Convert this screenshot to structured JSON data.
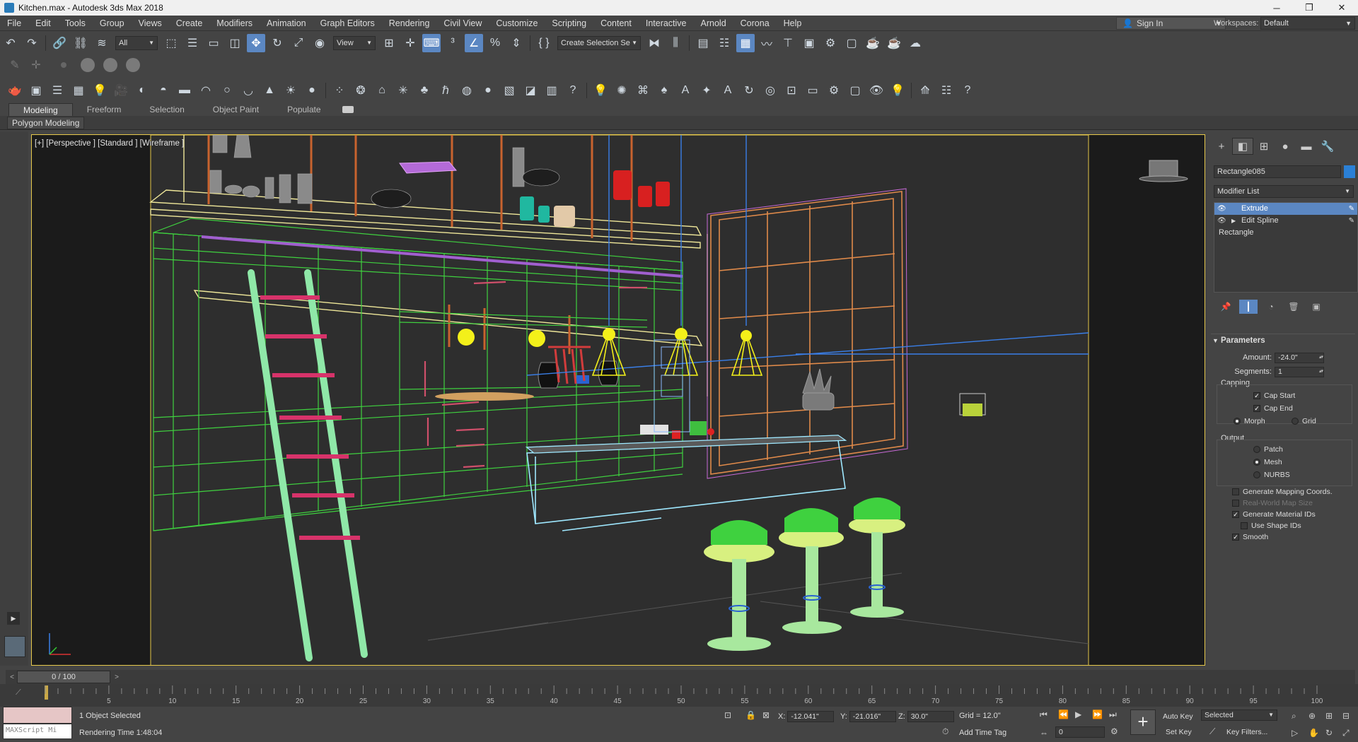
{
  "window": {
    "title": "Kitchen.max - Autodesk 3ds Max 2018",
    "minimize": "─",
    "restore": "❐",
    "close": "✕"
  },
  "menu": {
    "items": [
      "File",
      "Edit",
      "Tools",
      "Group",
      "Views",
      "Create",
      "Modifiers",
      "Animation",
      "Graph Editors",
      "Rendering",
      "Civil View",
      "Customize",
      "Scripting",
      "Content",
      "Interactive",
      "Arnold",
      "Corona",
      "Help"
    ],
    "sign_in": "Sign In",
    "workspaces_label": "Workspaces:",
    "workspace_value": "Default"
  },
  "toolbar": {
    "selection_filter": "All",
    "reference_coord": "View",
    "selection_set": "Create Selection Se"
  },
  "ribbon": {
    "tabs": [
      "Modeling",
      "Freeform",
      "Selection",
      "Object Paint",
      "Populate"
    ],
    "active_tab": "Modeling",
    "sub_panel": "Polygon Modeling"
  },
  "viewport": {
    "label": "[+] [Perspective ] [Standard ] [Wireframe ]",
    "colors": {
      "background": "#2a2a2a",
      "border": "#e6c84b",
      "cabinet": "#3fd13f",
      "ladder": "#8fe8a8",
      "ladder_rungs": "#d7336a",
      "window_frame": "#e08a4a",
      "shelf": "#f0e89a",
      "lamps": "#f3f01a",
      "island": "#9fe8ff",
      "stools": "#a8e89e",
      "light_lines": "#3a7fe8"
    }
  },
  "command_panel": {
    "tab_icons": [
      "create-icon",
      "modify-icon",
      "hierarchy-icon",
      "motion-icon",
      "display-icon",
      "utilities-icon"
    ],
    "object_name": "Rectangle085",
    "object_color": "#2b80d6",
    "modifier_list_label": "Modifier List",
    "stack": [
      {
        "name": "Extrude",
        "selected": true
      },
      {
        "name": "Edit Spline",
        "selected": false
      },
      {
        "name": "Rectangle",
        "selected": false
      }
    ],
    "parameters": {
      "title": "Parameters",
      "amount_label": "Amount:",
      "amount_value": "-24.0\"",
      "segments_label": "Segments:",
      "segments_value": "1",
      "capping_title": "Capping",
      "cap_start": "Cap Start",
      "cap_end": "Cap End",
      "morph": "Morph",
      "grid": "Grid",
      "output_title": "Output",
      "patch": "Patch",
      "mesh": "Mesh",
      "nurbs": "NURBS",
      "gen_mapping": "Generate Mapping Coords.",
      "real_world": "Real-World Map Size",
      "gen_material": "Generate Material IDs",
      "use_shape": "Use Shape IDs",
      "smooth": "Smooth"
    }
  },
  "timeline": {
    "frame_readout": "0 / 100",
    "ticks": [
      "5",
      "10",
      "15",
      "20",
      "25",
      "30",
      "35",
      "40",
      "45",
      "50",
      "55",
      "60",
      "65",
      "70",
      "75",
      "80",
      "85",
      "90",
      "95",
      "100"
    ]
  },
  "status": {
    "maxscript_placeholder": "MAXScript Mi",
    "selection_count": "1 Object Selected",
    "render_time": "Rendering Time  1:48:04",
    "x_label": "X:",
    "x_value": "-12.041\"",
    "y_label": "Y:",
    "y_value": "-21.016\"",
    "z_label": "Z:",
    "z_value": "30.0\"",
    "grid": "Grid = 12.0\"",
    "add_time_tag": "Add Time Tag",
    "auto_key": "Auto Key",
    "set_key": "Set Key",
    "selected": "Selected",
    "key_filters": "Key Filters...",
    "frame_field": "0"
  }
}
